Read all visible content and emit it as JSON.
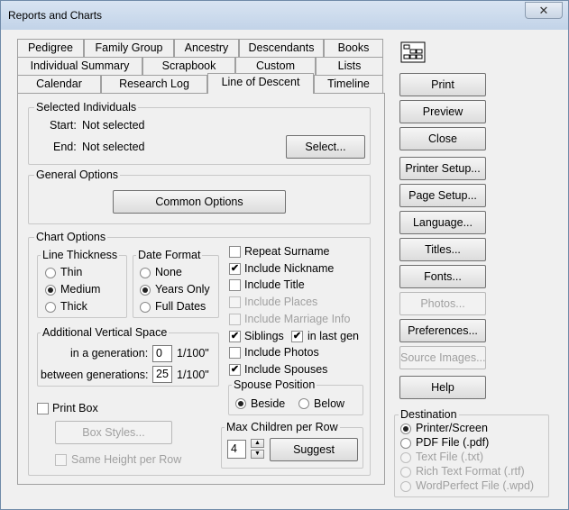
{
  "window": {
    "title": "Reports and Charts",
    "close_glyph": "✕"
  },
  "tabs": {
    "row1": [
      "Pedigree",
      "Family Group",
      "Ancestry",
      "Descendants",
      "Books"
    ],
    "row2": [
      "Individual Summary",
      "Scrapbook",
      "Custom",
      "Lists"
    ],
    "row3": [
      "Calendar",
      "Research Log",
      "Line of Descent",
      "Timeline"
    ],
    "active": "Line of Descent"
  },
  "selected_individuals": {
    "legend": "Selected Individuals",
    "start_label": "Start:",
    "start_value": "Not selected",
    "end_label": "End:",
    "end_value": "Not selected",
    "select_button": "Select..."
  },
  "general_options": {
    "legend": "General Options",
    "common_options_button": "Common Options"
  },
  "chart_options": {
    "legend": "Chart Options",
    "line_thickness": {
      "legend": "Line Thickness",
      "options": [
        "Thin",
        "Medium",
        "Thick"
      ],
      "selected": "Medium"
    },
    "date_format": {
      "legend": "Date Format",
      "options": [
        "None",
        "Years Only",
        "Full Dates"
      ],
      "selected": "Years Only"
    },
    "additional_vertical_space": {
      "legend": "Additional Vertical Space",
      "in_generation_label": "in a generation:",
      "in_generation_value": "0",
      "between_label": "between generations:",
      "between_value": "25",
      "unit": "1/100\""
    },
    "print_box_label": "Print Box",
    "box_styles_button": "Box Styles...",
    "same_height_label": "Same Height per Row",
    "checkboxes": {
      "repeat_surname": "Repeat Surname",
      "include_nickname": "Include Nickname",
      "include_title": "Include Title",
      "include_places": "Include Places",
      "include_marriage_info": "Include Marriage Info",
      "siblings": "Siblings",
      "in_last_gen": "in last gen",
      "include_photos": "Include Photos",
      "include_spouses": "Include Spouses"
    },
    "spouse_position": {
      "legend": "Spouse Position",
      "options": [
        "Beside",
        "Below"
      ],
      "selected": "Beside"
    },
    "max_children": {
      "legend": "Max Children per Row",
      "value": "4",
      "suggest_button": "Suggest"
    }
  },
  "side_buttons": {
    "print": "Print",
    "preview": "Preview",
    "close": "Close",
    "printer_setup": "Printer Setup...",
    "page_setup": "Page Setup...",
    "language": "Language...",
    "titles": "Titles...",
    "fonts": "Fonts...",
    "photos": "Photos...",
    "preferences": "Preferences...",
    "source_images": "Source Images...",
    "help": "Help"
  },
  "destination": {
    "legend": "Destination",
    "options": [
      "Printer/Screen",
      "PDF File (.pdf)",
      "Text File (.txt)",
      "Rich Text Format (.rtf)",
      "WordPerfect File (.wpd)"
    ],
    "selected": "Printer/Screen"
  },
  "icons": {
    "report_icon": "report-chart-icon",
    "check_glyph": "✔",
    "up_glyph": "▲",
    "down_glyph": "▼"
  }
}
